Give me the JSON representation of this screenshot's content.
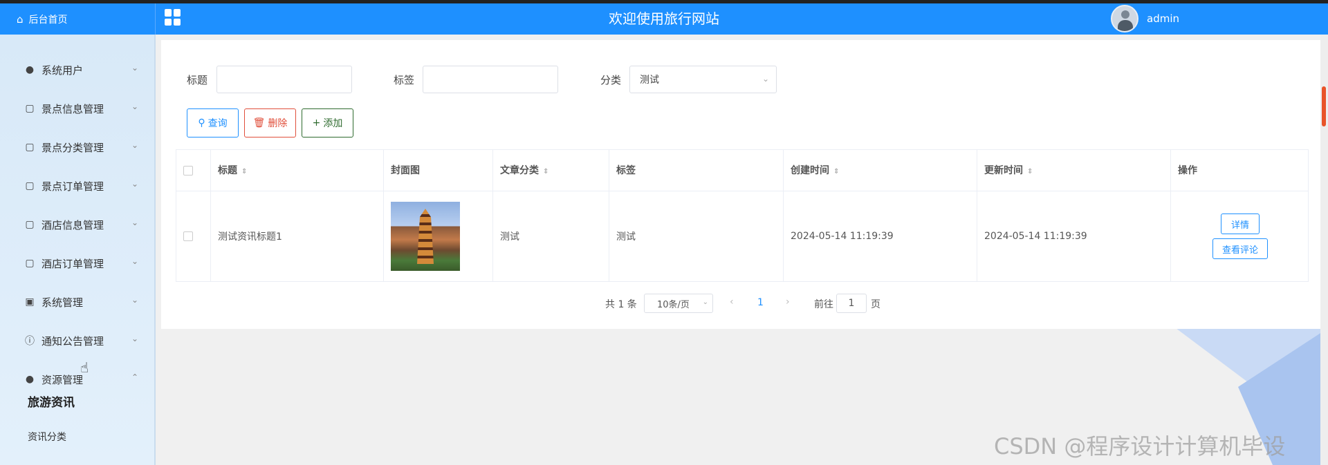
{
  "header": {
    "home_label": "后台首页",
    "title": "欢迎使用旅行网站",
    "username": "admin"
  },
  "sidebar": {
    "items": [
      {
        "label": "系统用户",
        "icon": "user-icon"
      },
      {
        "label": "景点信息管理",
        "icon": "file-icon"
      },
      {
        "label": "景点分类管理",
        "icon": "file-icon"
      },
      {
        "label": "景点订单管理",
        "icon": "file-icon"
      },
      {
        "label": "酒店信息管理",
        "icon": "file-icon"
      },
      {
        "label": "酒店订单管理",
        "icon": "file-icon"
      },
      {
        "label": "系统管理",
        "icon": "picture-icon"
      },
      {
        "label": "通知公告管理",
        "icon": "info-icon"
      },
      {
        "label": "资源管理",
        "icon": "bulb-icon"
      }
    ],
    "sub_items": [
      {
        "label": "旅游资讯",
        "active": true
      },
      {
        "label": "资讯分类",
        "active": false
      }
    ]
  },
  "search": {
    "title_label": "标题",
    "tag_label": "标签",
    "category_label": "分类",
    "category_value": "测试",
    "query_button": "查询",
    "delete_button": "删除",
    "add_button": "添加"
  },
  "table": {
    "columns": [
      "标题",
      "封面图",
      "文章分类",
      "标签",
      "创建时间",
      "更新时间",
      "操作"
    ],
    "rows": [
      {
        "title": "测试资讯标题1",
        "category": "测试",
        "tag": "测试",
        "created": "2024-05-14 11:19:39",
        "updated": "2024-05-14 11:19:39",
        "detail_button": "详情",
        "comment_button": "查看评论"
      }
    ]
  },
  "pagination": {
    "total": "共 1 条",
    "page_size": "10条/页",
    "current_page": "1",
    "goto_label": "前往",
    "goto_value": "1",
    "page_suffix": "页"
  },
  "watermark": "CSDN @程序设计计算机毕设",
  "colors": {
    "primary": "#1e90ff",
    "danger": "#e04e3a",
    "success": "#2d6a2d"
  }
}
